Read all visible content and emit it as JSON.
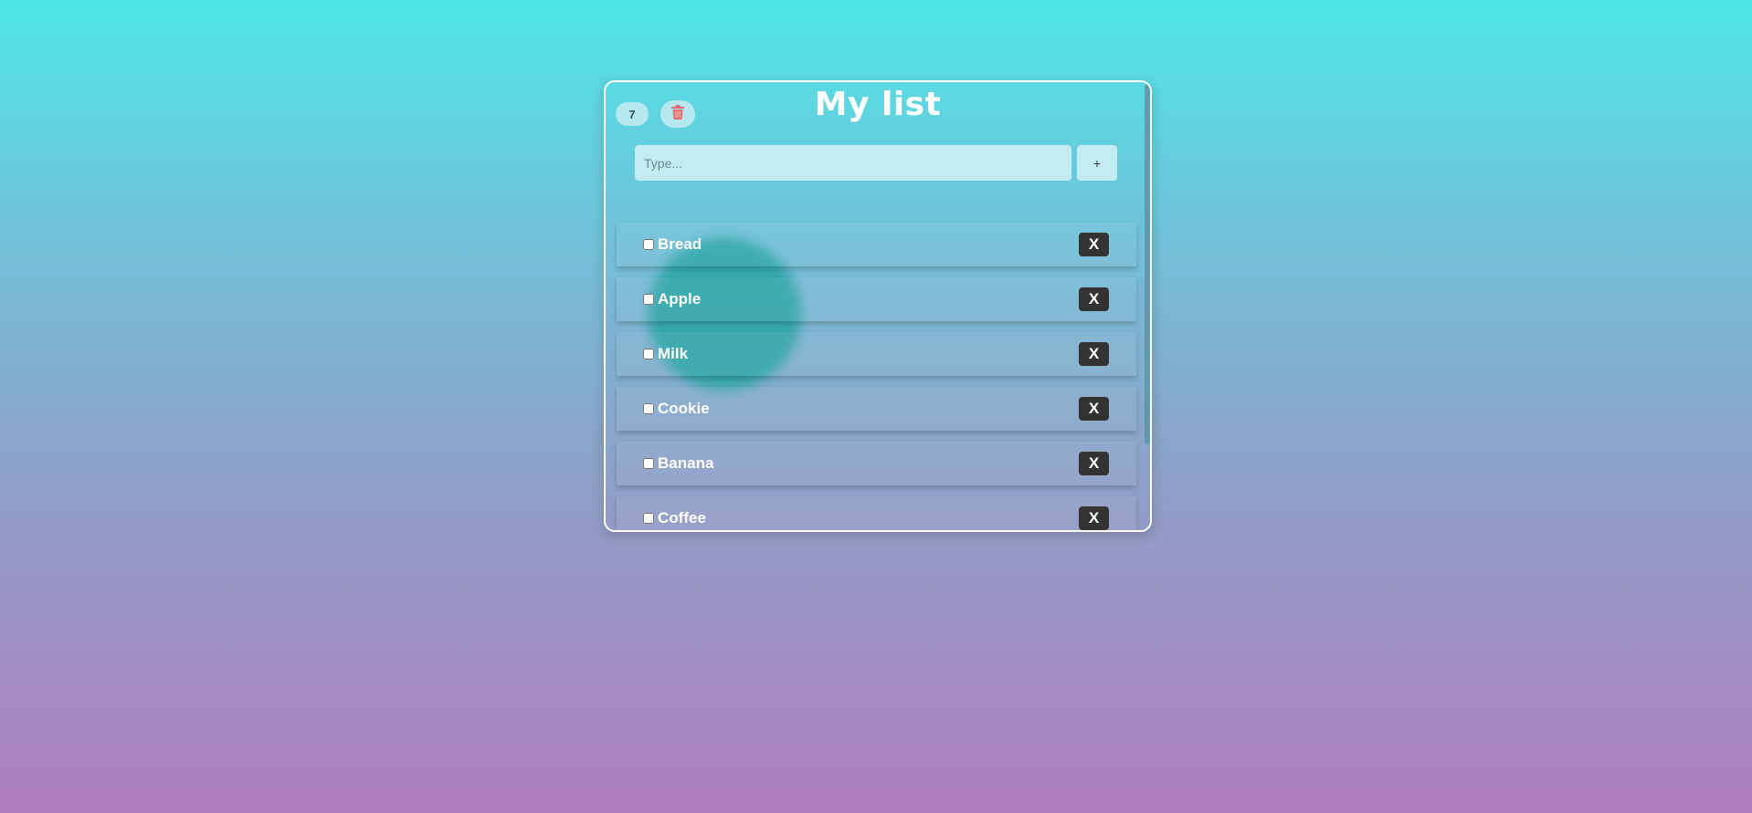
{
  "header": {
    "title": "My list",
    "item_count": "7",
    "trash_icon": "trash-icon"
  },
  "input": {
    "placeholder": "Type...",
    "value": "",
    "add_label": "+"
  },
  "items": [
    {
      "label": "Bread",
      "checked": false,
      "delete_label": "X"
    },
    {
      "label": "Apple",
      "checked": false,
      "delete_label": "X"
    },
    {
      "label": "Milk",
      "checked": false,
      "delete_label": "X"
    },
    {
      "label": "Cookie",
      "checked": false,
      "delete_label": "X"
    },
    {
      "label": "Banana",
      "checked": false,
      "delete_label": "X"
    },
    {
      "label": "Coffee",
      "checked": false,
      "delete_label": "X"
    }
  ],
  "colors": {
    "trash": "#e86a6a",
    "delete_bg": "#333333",
    "accent": "#c2ecf2"
  }
}
